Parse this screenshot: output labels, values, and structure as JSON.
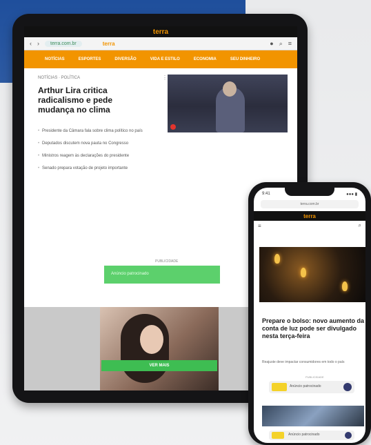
{
  "tablet": {
    "brand": "terra",
    "url": "terra.com.br",
    "header_logo": "terra",
    "nav": [
      "NOTÍCIAS",
      "ESPORTES",
      "DIVERSÃO",
      "VIDA E ESTILO",
      "ECONOMIA",
      "SEU DINHEIRO"
    ],
    "kicker": "NOTÍCIAS · POLÍTICA",
    "headline": "Arthur Lira critica radicalismo e pede mudança no clima",
    "bullets": [
      "Presidente da Câmara fala sobre clima político no país",
      "Deputados discutem nova pauta no Congresso",
      "Ministros reagem às declarações do presidente",
      "Senado prepara votação de projeto importante"
    ],
    "ad_label": "PUBLICIDADE",
    "ad_text": "Anúncio patrocinado",
    "banner_cta": "VER MAIS"
  },
  "phone": {
    "time": "9:41",
    "signal": "●●● ▮",
    "url": "terra.com.br",
    "brand": "terra",
    "headline": "Prepare o bolso: novo aumento da conta de luz pode ser divulgado nesta terça-feira",
    "sub": "Reajuste deve impactar consumidores em todo o país",
    "ad_label": "PUBLICIDADE",
    "ad1_text": "Anúncio patrocinado",
    "ad2_text": "Anúncio patrocinado"
  },
  "icons": {
    "tablet_back": "back-icon",
    "tablet_menu": "menu-icon",
    "tablet_search": "search-icon",
    "phone_menu": "menu-icon",
    "phone_search": "search-icon"
  },
  "colors": {
    "accent": "#f29400",
    "brand_blue": "#1f4f9c",
    "ad_green": "#5cd06c"
  }
}
